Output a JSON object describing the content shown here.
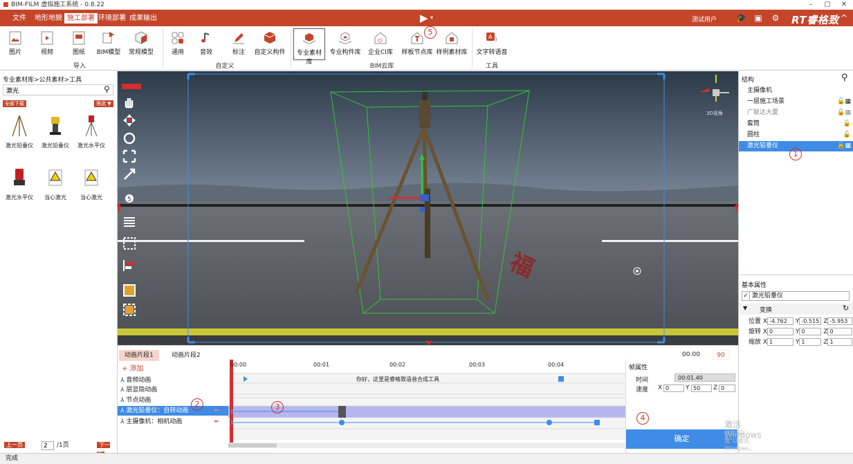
{
  "window": {
    "title": "BIM-FILM 虚拟施工系统 - 0.8.22"
  },
  "menubar": {
    "items": [
      "文件",
      "地形地貌",
      "施工部署",
      "环境部署",
      "成果输出"
    ],
    "active": "施工部署",
    "user": "测试用户",
    "brand": "RT睿格致"
  },
  "ribbon": {
    "buttons": [
      "图片",
      "视频",
      "图纸",
      "BIM模型",
      "常规模型",
      "通用",
      "音效",
      "标注",
      "自定义构件",
      "专业素材库",
      "专业构件库",
      "企业CI库",
      "样板节点库",
      "样例素材库",
      "文字转语音"
    ],
    "groups": [
      "导入",
      "自定义",
      "BIM云库",
      "工具"
    ]
  },
  "library": {
    "breadcrumb": "专业素材库>公共素材>工具",
    "search_value": "激光",
    "tag_download": "全部下载",
    "tag_filter": "筛选",
    "assets": [
      "激光铅垂仪",
      "激光铅垂仪",
      "激光水平仪",
      "激光水平仪",
      "当心激光",
      "当心激光"
    ],
    "pager": {
      "prev": "上一页",
      "page": "2",
      "total": "/1页",
      "next": "下一页"
    }
  },
  "viewport": {
    "view_label": "3D视角"
  },
  "structure": {
    "title": "结构",
    "items": [
      "主摄像机",
      "一层施工场景",
      "广联达大厦",
      "套筒",
      "圆柱",
      "激光铅垂仪"
    ],
    "selected": "激光铅垂仪"
  },
  "properties": {
    "title": "基本属性",
    "name_value": "激光铅垂仪",
    "transform_label": "变换",
    "position_label": "位置",
    "rotation_label": "旋转",
    "scale_label": "缩放",
    "position": {
      "x": "-4.762",
      "y": "-0.515",
      "z": "-5.953"
    },
    "rotation": {
      "x": "0",
      "y": "0",
      "z": "0"
    },
    "scale": {
      "x": "1",
      "y": "1",
      "z": "1"
    }
  },
  "timeline": {
    "tabs": [
      "动画片段1",
      "动画片段2"
    ],
    "add_label": "+ 添加",
    "time_display": "00:00",
    "frame_count": "90",
    "ticks": [
      "00:00",
      "00:01",
      "00:02",
      "00:03",
      "00:04"
    ],
    "tracks": [
      "音频动画",
      "层显隐动画",
      "节点动画",
      "激光铅垂仪：自转动画",
      "主摄像机：相机动画"
    ],
    "audio_clip_text": "你好，这里是睿格致语音合成工具"
  },
  "frame_props": {
    "title": "帧属性",
    "time_label": "时间",
    "time_value": "00:01.40",
    "speed_label": "速度",
    "speed": {
      "x": "0",
      "y": "50",
      "z": "0"
    },
    "confirm": "确定"
  },
  "annotations": [
    "1",
    "2",
    "3",
    "4",
    "5"
  ],
  "watermark": {
    "line1": "激活 Windows",
    "line2": "转到\"设置\"以激活 Windows。"
  },
  "status": "完成",
  "colors": {
    "accent": "#c4452a",
    "selection": "#3e8ce6"
  }
}
